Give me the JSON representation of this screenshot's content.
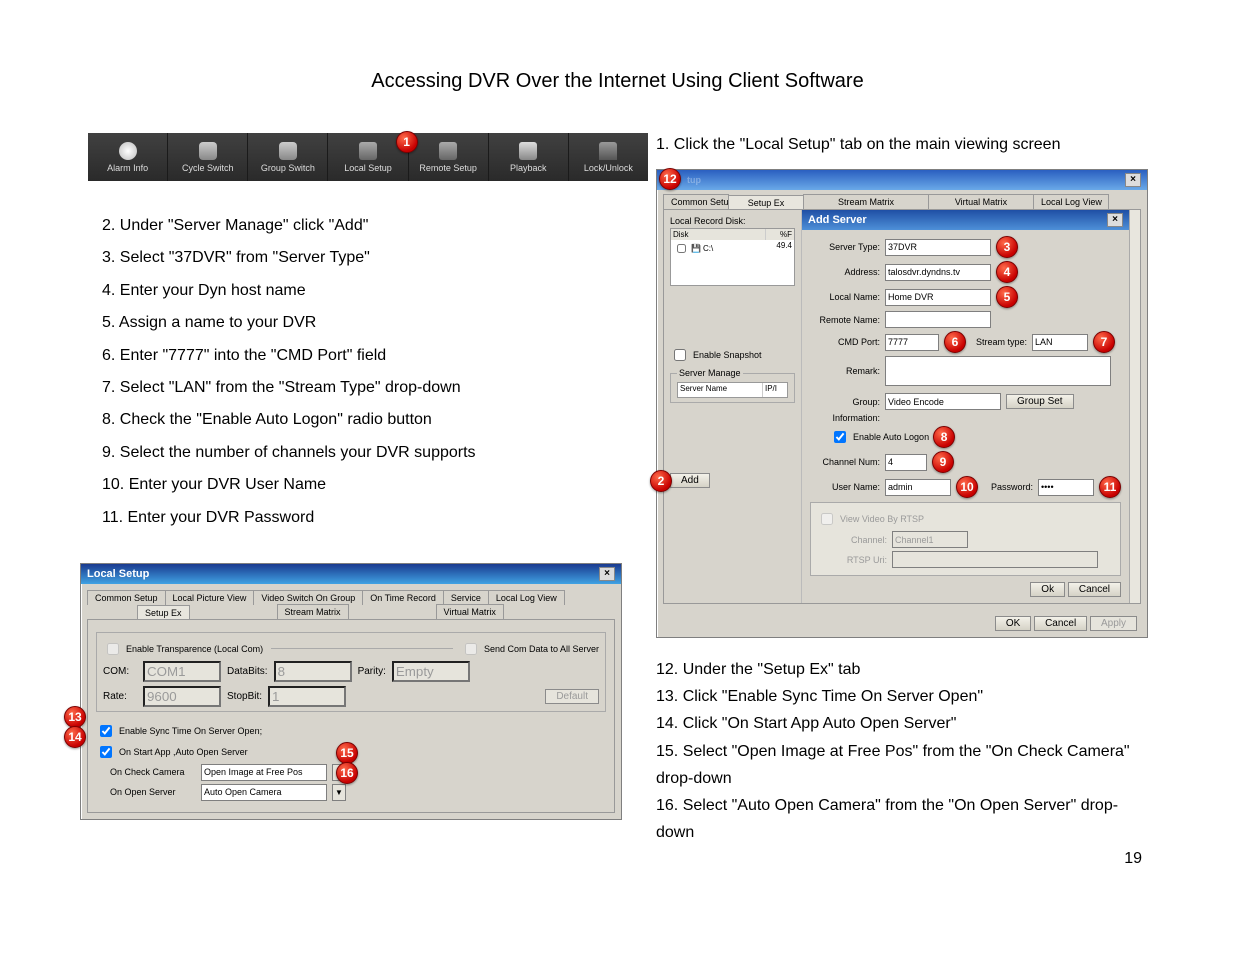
{
  "title": "Accessing DVR Over the Internet Using Client Software",
  "toolbar": {
    "items": [
      {
        "label": "Alarm Info"
      },
      {
        "label": "Cycle Switch"
      },
      {
        "label": "Group Switch"
      },
      {
        "label": "Local Setup"
      },
      {
        "label": "Remote Setup"
      },
      {
        "label": "Playback"
      },
      {
        "label": "Lock/Unlock"
      }
    ],
    "marker1": "1"
  },
  "steps_left": [
    "2. Under \"Server Manage\" click \"Add\"",
    "3. Select \"37DVR\" from \"Server Type\"",
    "4. Enter your Dyn host name",
    "5. Assign a name to your DVR",
    "6. Enter \"7777\" into the \"CMD Port\" field",
    "7. Select \"LAN\" from the \"Stream Type\" drop-down",
    "8. Check the \"Enable Auto Logon\" radio button",
    "9. Select the number of channels your DVR supports",
    "10. Enter your DVR User Name",
    "11. Enter your DVR Password"
  ],
  "right_intro": "1. Click the \"Local Setup\" tab on the main viewing screen",
  "addserver": {
    "title_window": "Local Setup",
    "tabs_row1": [
      "Common Setup",
      "",
      "Stream Matrix",
      "",
      "Virtual Matrix"
    ],
    "dialog_title": "Add Server",
    "local_record_disk_label": "Local Record Disk:",
    "disk_hdr1": "Disk",
    "disk_hdr2": "%F",
    "disk_row1a": "C:\\",
    "disk_row1b": "49.4",
    "enable_snapshot": "Enable Snapshot",
    "server_manage": "Server Manage",
    "server_name_hdr": "Server Name",
    "ip_hdr": "IP/I",
    "add_btn": "Add",
    "setup_ex": "Setup Ex",
    "local_log_view": "Local Log View",
    "fields": {
      "server_type_l": "Server Type:",
      "server_type_v": "37DVR",
      "address_l": "Address:",
      "address_v": "talosdvr.dyndns.tv",
      "local_name_l": "Local Name:",
      "local_name_v": "Home DVR",
      "remote_name_l": "Remote Name:",
      "cmd_port_l": "CMD Port:",
      "cmd_port_v": "7777",
      "stream_type_l": "Stream type:",
      "stream_type_v": "LAN",
      "remark_l": "Remark:",
      "group_l": "Group:",
      "group_v": "Video Encode",
      "group_set": "Group Set",
      "info_l": "Information:",
      "enable_auto": "Enable Auto Logon",
      "channel_num_l": "Channel Num:",
      "channel_num_v": "4",
      "user_l": "User Name:",
      "user_v": "admin",
      "pass_l": "Password:",
      "pass_v": "••••",
      "view_rtsp": "View Video By RTSP",
      "channel_l": "Channel:",
      "channel_v": "Channel1",
      "rtsp_l": "RTSP Uri:",
      "ok": "Ok",
      "cancel": "Cancel",
      "ok2": "OK",
      "cancel2": "Cancel",
      "apply": "Apply"
    },
    "markers": {
      "m2": "2",
      "m3": "3",
      "m4": "4",
      "m5": "5",
      "m6": "6",
      "m7": "7",
      "m8": "8",
      "m9": "9",
      "m10": "10",
      "m11": "11",
      "m12": "12"
    }
  },
  "localsetup": {
    "title": "Local Setup",
    "tabs1": [
      "Common Setup",
      "Local Picture View",
      "Video Switch On Group",
      "On Time Record",
      "Service",
      "Local Log View"
    ],
    "tabs2": [
      "Setup Ex",
      "Stream Matrix",
      "Virtual Matrix"
    ],
    "enable_transparence": "Enable Transparence (Local Com)",
    "send_all": "Send Com Data to All Server",
    "com_l": "COM:",
    "com_v": "COM1",
    "databits_l": "DataBits:",
    "databits_v": "8",
    "parity_l": "Parity:",
    "parity_v": "Empty",
    "rate_l": "Rate:",
    "rate_v": "9600",
    "stopbit_l": "StopBit:",
    "stopbit_v": "1",
    "default": "Default",
    "enable_sync": "Enable Sync Time On Server Open;",
    "on_start": "On Start App ,Auto Open Server",
    "on_check_l": "On Check Camera",
    "on_check_v": "Open Image at Free Pos",
    "on_open_l": "On Open Server",
    "on_open_v": "Auto Open Camera",
    "markers": {
      "m13": "13",
      "m14": "14",
      "m15": "15",
      "m16": "16"
    }
  },
  "steps_right": [
    "12. Under the \"Setup Ex\" tab",
    "13. Click \"Enable Sync Time On Server Open\"",
    "14. Click \"On Start App Auto Open Server\"",
    "15. Select \"Open Image at Free Pos\" from the \"On Check Camera\" drop-down",
    "16. Select \"Auto Open Camera\" from the \"On Open Server\" drop-down"
  ],
  "page_number": "19"
}
